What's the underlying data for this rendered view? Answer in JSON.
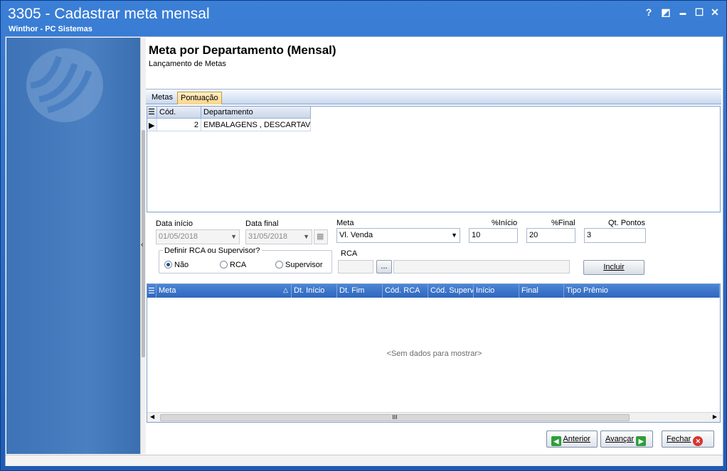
{
  "window": {
    "title": "3305 - Cadastrar meta mensal",
    "subtitle": "Winthor - PC Sistemas",
    "help": "?",
    "minimize": "▬",
    "maximize": "☐",
    "close": "✕"
  },
  "header": {
    "title": "Meta por Departamento (Mensal)",
    "subtitle": "Lançamento de Metas"
  },
  "tabs": [
    {
      "label": "Metas",
      "active": false
    },
    {
      "label": "Pontuação",
      "active": true
    }
  ],
  "dept_grid": {
    "columns": [
      "Cód.",
      "Departamento"
    ],
    "rows": [
      {
        "cod": "2",
        "departamento": "EMBALAGENS , DESCARTAVEIS"
      }
    ]
  },
  "form": {
    "data_inicio_label": "Data início",
    "data_inicio_value": "01/05/2018",
    "data_final_label": "Data final",
    "data_final_value": "31/05/2018",
    "meta_label": "Meta",
    "meta_value": "Vl. Venda",
    "pct_inicio_label": "%Início",
    "pct_inicio_value": "10",
    "pct_final_label": "%Final",
    "pct_final_value": "20",
    "qt_pontos_label": "Qt. Pontos",
    "qt_pontos_value": "3",
    "rca_group_title": "Definir RCA ou Supervisor?",
    "radio_nao": "Não",
    "radio_rca": "RCA",
    "radio_supervisor": "Supervisor",
    "selected_option": "Não",
    "rca_label": "RCA",
    "rca_browse": "...",
    "incluir_label": "Incluir"
  },
  "results_grid": {
    "columns": [
      "Meta",
      "Dt. Início",
      "Dt. Fim",
      "Cód. RCA",
      "Cód. Superv",
      "Início",
      "Final",
      "Tipo Prêmio"
    ],
    "empty_text": "<Sem dados para mostrar>",
    "scroll_grip": "III"
  },
  "footer": {
    "anterior": "Anterior",
    "avancar": "Avançar",
    "fechar": "Fechar"
  },
  "colors": {
    "title_bar": "#2a63b8",
    "side_panel": "#4a80c2",
    "grid_header": "#2e66bd",
    "anterior_icon": "#2e9e3a",
    "avancar_icon": "#2e9e3a",
    "fechar_icon": "#d9342b"
  }
}
